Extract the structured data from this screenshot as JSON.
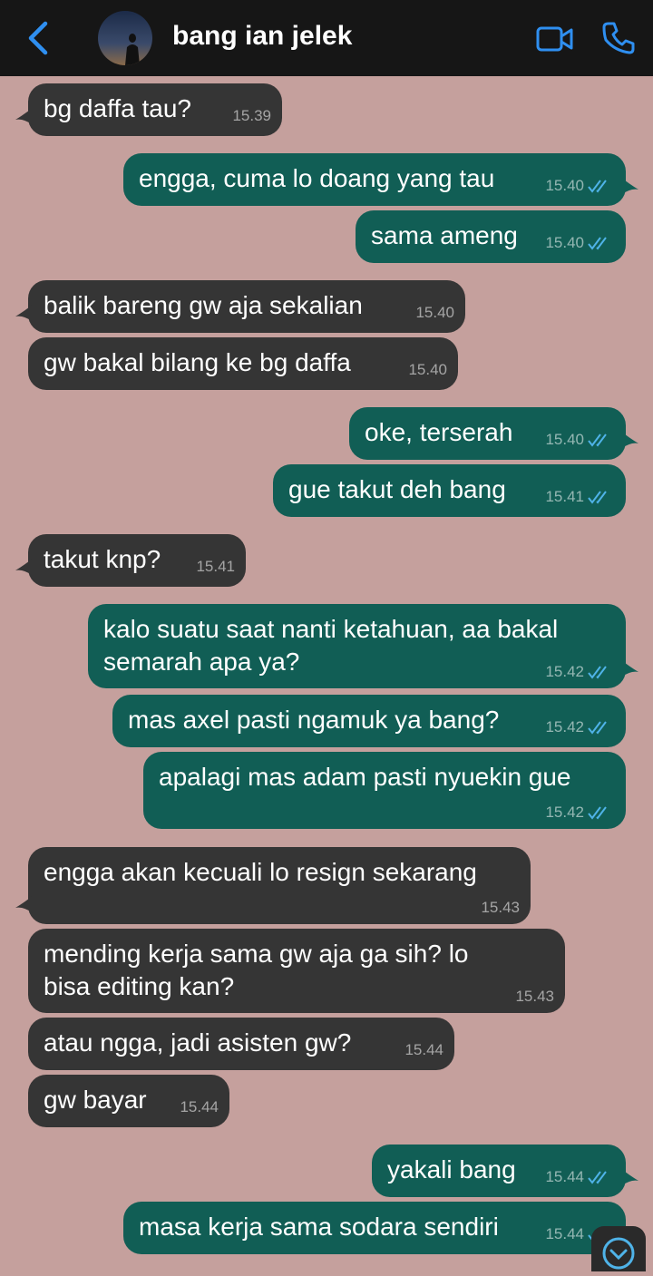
{
  "header": {
    "contact_name": "bang ian jelek",
    "accent_color": "#2f8ff0",
    "icons": [
      "chevron-left-icon",
      "avatar",
      "video-camera-icon",
      "phone-icon"
    ]
  },
  "messages": [
    {
      "dir": "in",
      "text": "bg daffa tau?",
      "time": "15.39"
    },
    {
      "dir": "out",
      "text": "engga, cuma lo doang yang tau",
      "time": "15.40",
      "read": true
    },
    {
      "dir": "out",
      "text": "sama ameng",
      "time": "15.40",
      "read": true
    },
    {
      "dir": "in",
      "text": "balik bareng gw aja sekalian",
      "time": "15.40"
    },
    {
      "dir": "in",
      "text": "gw bakal bilang ke bg daffa",
      "time": "15.40"
    },
    {
      "dir": "out",
      "text": "oke, terserah",
      "time": "15.40",
      "read": true
    },
    {
      "dir": "out",
      "text": "gue takut deh bang",
      "time": "15.41",
      "read": true
    },
    {
      "dir": "in",
      "text": "takut knp?",
      "time": "15.41"
    },
    {
      "dir": "out",
      "text": "kalo suatu saat nanti ketahuan, aa bakal\nsemarah apa ya?",
      "time": "15.42",
      "read": true
    },
    {
      "dir": "out",
      "text": "mas axel pasti ngamuk ya bang?",
      "time": "15.42",
      "read": true
    },
    {
      "dir": "out",
      "text": "apalagi mas adam pasti nyuekin gue",
      "time": "15.42",
      "read": true
    },
    {
      "dir": "in",
      "text": "engga akan kecuali lo resign sekarang",
      "time": "15.43"
    },
    {
      "dir": "in",
      "text": "mending kerja sama gw aja ga sih? lo\nbisa editing kan?",
      "time": "15.43"
    },
    {
      "dir": "in",
      "text": "atau ngga, jadi asisten gw?",
      "time": "15.44"
    },
    {
      "dir": "in",
      "text": "gw bayar",
      "time": "15.44"
    },
    {
      "dir": "out",
      "text": "yakali bang",
      "time": "15.44",
      "read": true
    },
    {
      "dir": "out",
      "text": "masa kerja sama sodara sendiri",
      "time": "15.44",
      "read": true
    }
  ],
  "colors": {
    "background": "#c5a09d",
    "incoming_bubble": "#353535",
    "outgoing_bubble": "#115e55",
    "header": "#161616",
    "read_ticks": "#4fb3e8"
  }
}
